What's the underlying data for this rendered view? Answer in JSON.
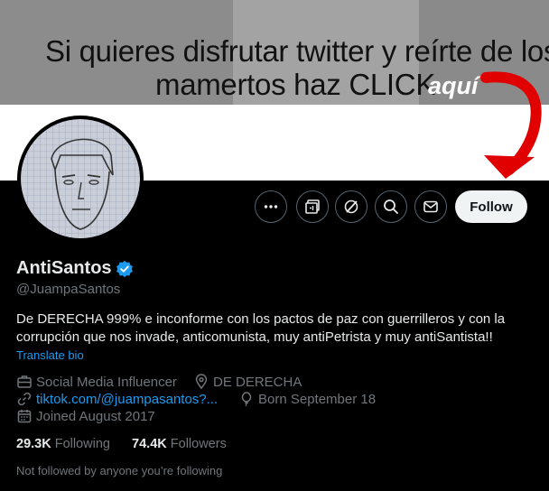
{
  "banner": {
    "line1": "Si quieres disfrutar twitter y reírte de los",
    "line2": "mamertos haz CLICK",
    "highlight": "aquí"
  },
  "actions": {
    "more_icon": "more-icon",
    "subscribe_icon": "subscribe-icon",
    "grok_icon": "grok-icon",
    "search_icon": "search-icon",
    "message_icon": "message-icon",
    "follow_label": "Follow"
  },
  "profile": {
    "name": "AntiSantos",
    "handle": "@JuampaSantos",
    "bio": "De DERECHA 999% e inconforme con los pactos de paz con guerrilleros y con la corrupción que nos invade, anticomunista, muy antiPetrista y muy antiSantista!!",
    "translate_label": "Translate bio",
    "category": "Social Media Influencer",
    "location": "DE DERECHA",
    "website": "tiktok.com/@juampasantos?...",
    "born": "Born September 18",
    "joined": "Joined August 2017",
    "following_count": "29.3K",
    "following_label": "Following",
    "followers_count": "74.4K",
    "followers_label": "Followers",
    "not_followed": "Not followed by anyone you’re following"
  },
  "colors": {
    "accent": "#1d9bf0",
    "arrow_red": "#e00000"
  }
}
